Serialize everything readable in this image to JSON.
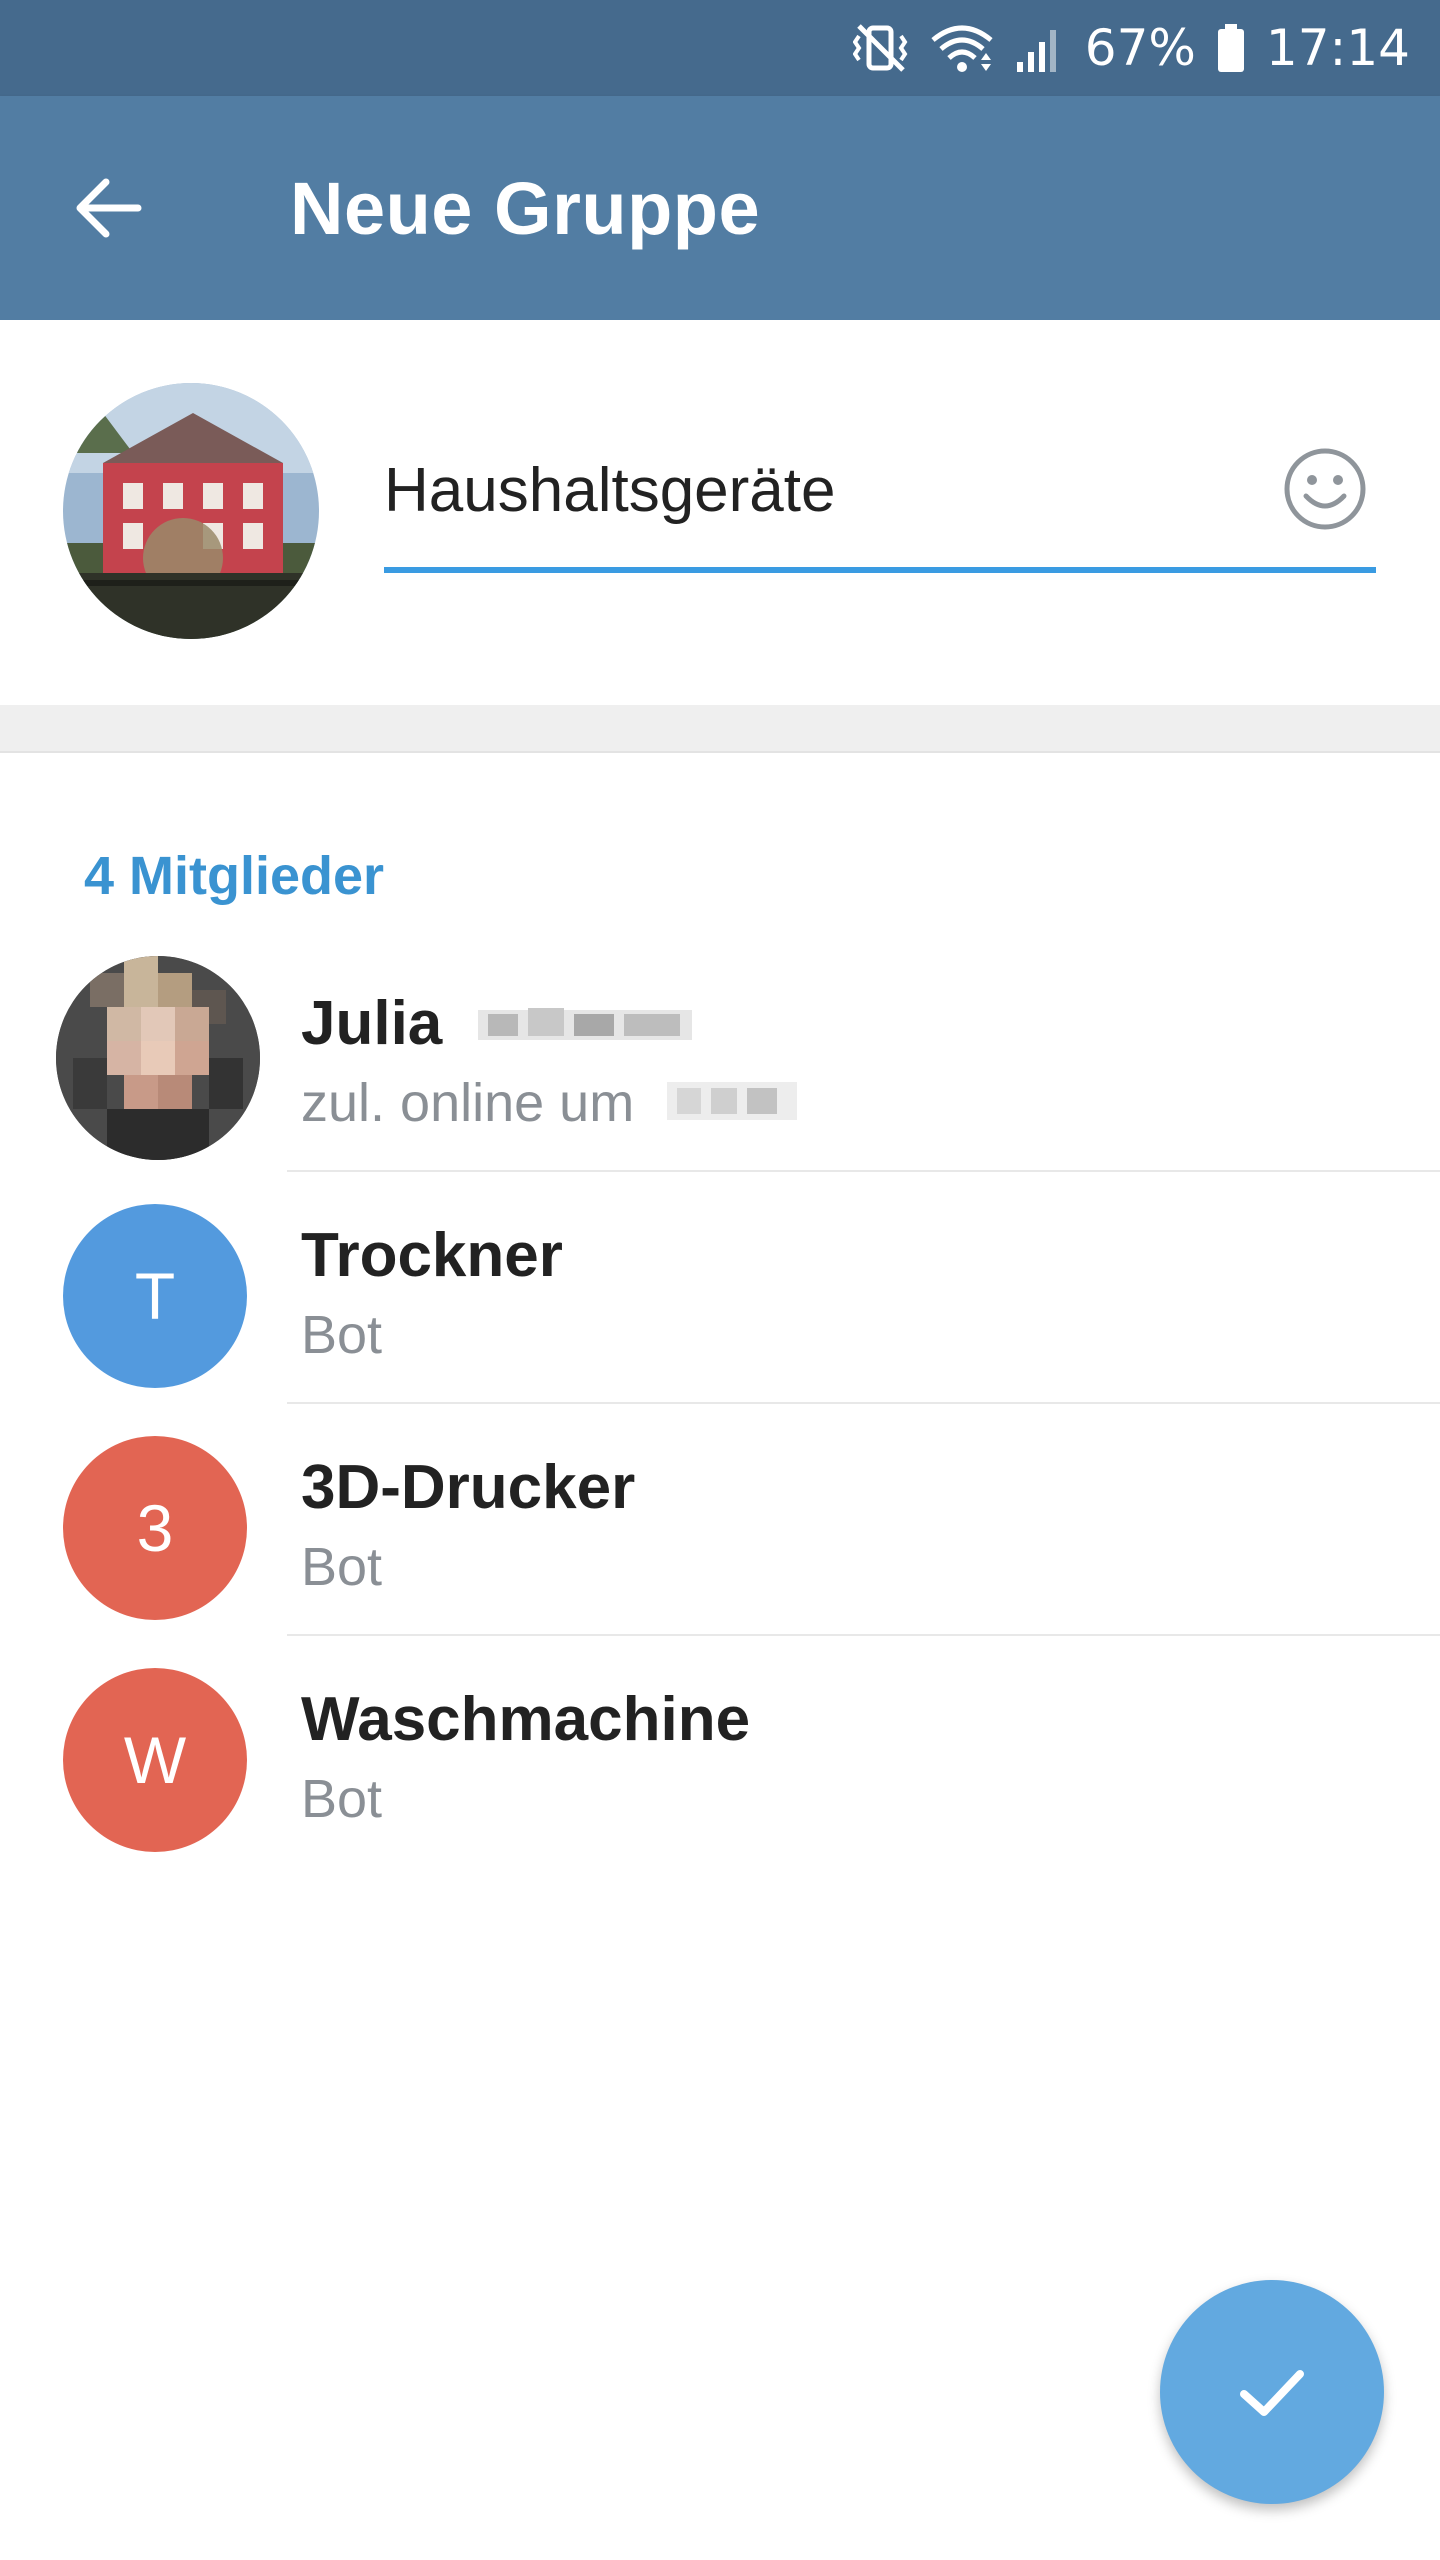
{
  "status_bar": {
    "battery_percent": "67%",
    "time": "17:14",
    "icons": [
      "vibrate-mute-icon",
      "wifi-icon",
      "signal-icon",
      "battery-icon"
    ]
  },
  "app_bar": {
    "title": "Neue Gruppe",
    "back_icon": "arrow-back-icon"
  },
  "group": {
    "name_value": "Haushaltsgeräte",
    "emoji_icon": "smiley-icon",
    "underline_color": "#3a9be2"
  },
  "members": {
    "header": "4 Mitglieder",
    "items": [
      {
        "name": "Julia",
        "status": "zul. online um",
        "avatar_type": "photo"
      },
      {
        "name": "Trockner",
        "status": "Bot",
        "initial": "T",
        "color": "#539ade"
      },
      {
        "name": "3D-Drucker",
        "status": "Bot",
        "initial": "3",
        "color": "#e26553"
      },
      {
        "name": "Waschmachine",
        "status": "Bot",
        "initial": "W",
        "color": "#e26553"
      }
    ]
  },
  "fab": {
    "icon": "check-icon",
    "color": "#62a9e0"
  },
  "colors": {
    "status_bar": "#456a8d",
    "app_bar": "#527da3",
    "accent": "#3a93d1"
  }
}
